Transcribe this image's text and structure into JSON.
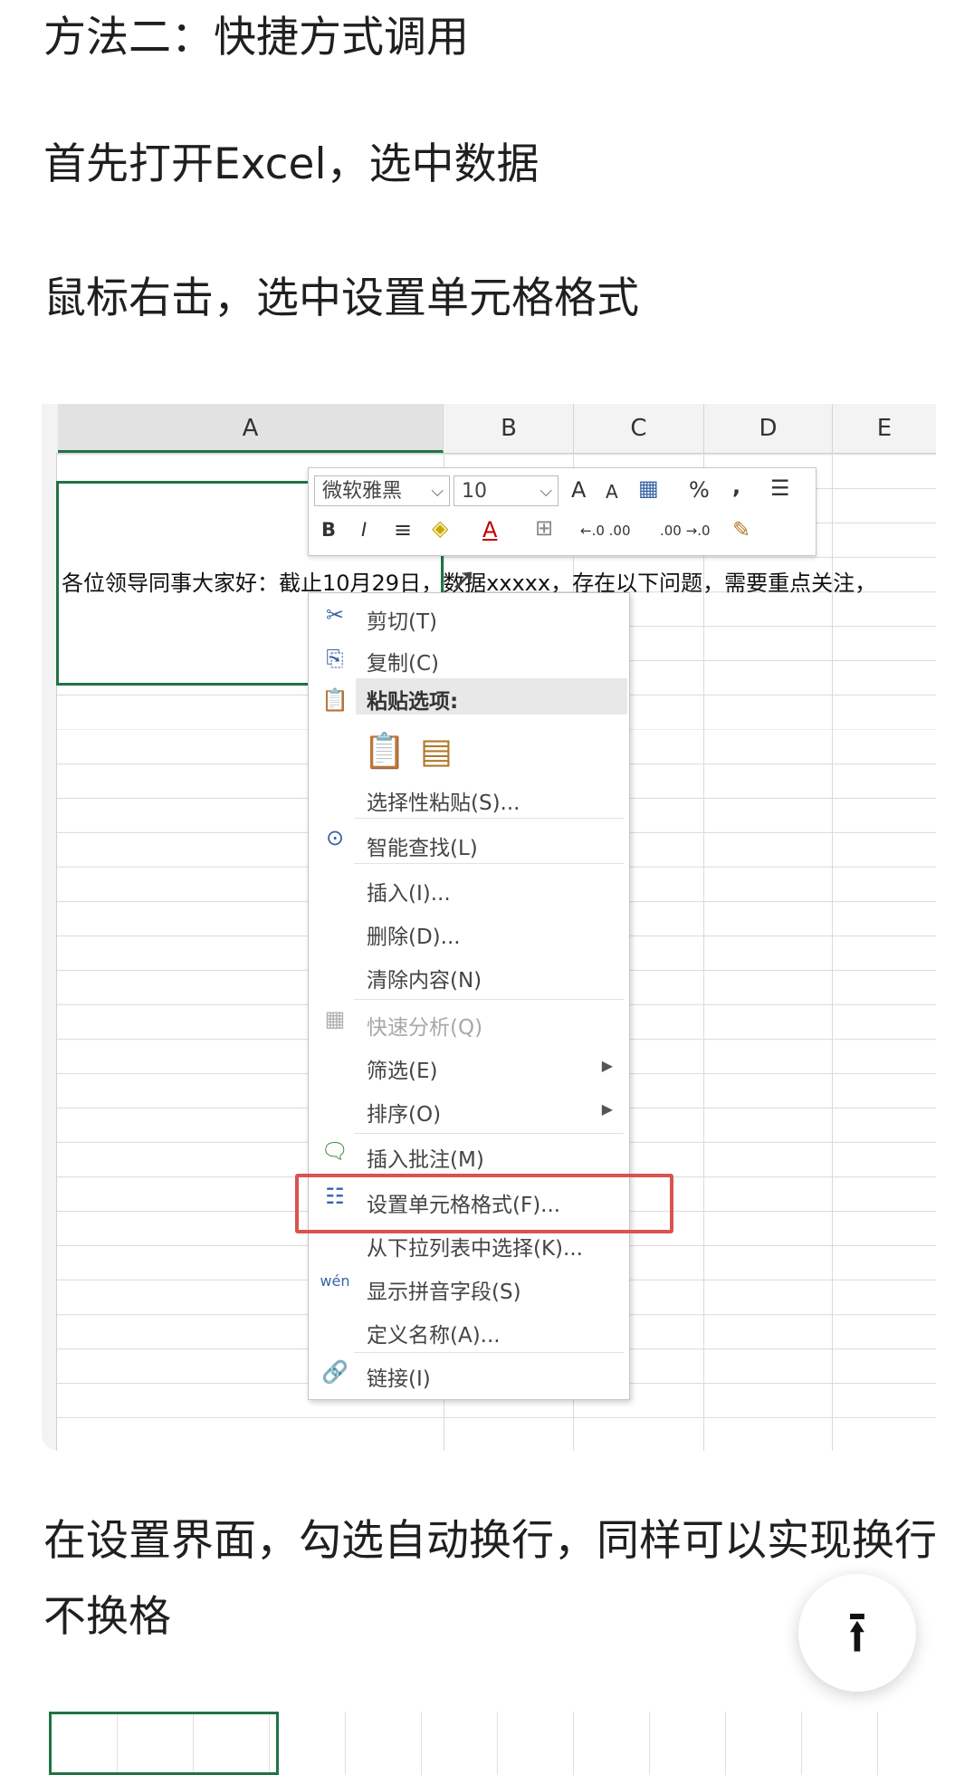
{
  "paragraphs": {
    "p1": "方法二：快捷方式调用",
    "p2": "首先打开Excel，选中数据",
    "p3": "鼠标右击，选中设置单元格格式",
    "p4": "在设置界面，勾选自动换行，同样可以实现换行不换格"
  },
  "excel": {
    "columns": [
      "A",
      "B",
      "C",
      "D",
      "E"
    ],
    "cell_text": "各位领导同事大家好：截止10月29日，数据xxxxx，存在以下问题，需要重点关注，",
    "mini_toolbar": {
      "font": "微软雅黑",
      "size": "10",
      "grow_font": "A",
      "shrink_font": "A",
      "percent": "%",
      "comma": ",",
      "bold": "B",
      "italic": "I",
      "font_color": "A",
      "inc_decimal": "←.0 .00",
      "dec_decimal": ".00 →.0"
    },
    "context_menu": {
      "cut": "剪切(T)",
      "copy": "复制(C)",
      "paste_options": "粘贴选项:",
      "paste_special": "选择性粘贴(S)...",
      "smart_lookup": "智能查找(L)",
      "insert": "插入(I)...",
      "delete": "删除(D)...",
      "clear": "清除内容(N)",
      "quick_analysis": "快速分析(Q)",
      "filter": "筛选(E)",
      "sort": "排序(O)",
      "insert_comment": "插入批注(M)",
      "format_cells": "设置单元格格式(F)...",
      "pick_list": "从下拉列表中选择(K)...",
      "phonetic": "显示拼音字段(S)",
      "define_name": "定义名称(A)...",
      "link": "链接(I)"
    },
    "accent": "#217346",
    "highlight": "#d9534f"
  },
  "back_to_top": "⭱"
}
